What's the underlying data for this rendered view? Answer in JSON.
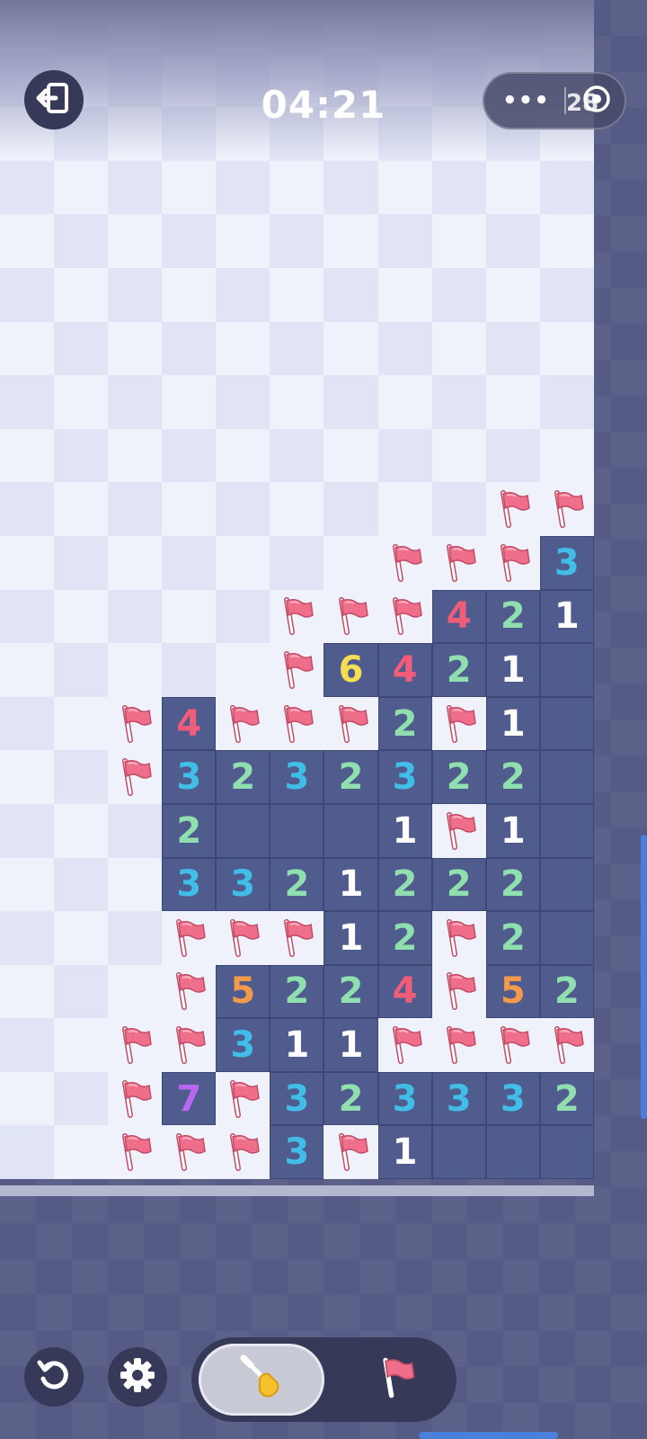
{
  "header": {
    "timer": "04:21",
    "capsule_dots": "•••",
    "flag_count": "28"
  },
  "icons": {
    "exit": "exit-door-icon",
    "restart": "restart-icon",
    "settings": "gear-icon",
    "dig": "shovel-icon",
    "flag": "flag-icon",
    "close": "close-circle-icon"
  },
  "colors": {
    "revealed": "#505c8e",
    "hidden_light": "#eff1fb",
    "hidden_dark": "#e0e4f4",
    "flag": "#ef6f8a",
    "n1": "#ffffff",
    "n2": "#8fe0ae",
    "n3": "#41bee8",
    "n4": "#ef5d78",
    "n5": "#f39a4a",
    "n6": "#f4df54",
    "n7": "#b768f2"
  },
  "board": {
    "cols": 11,
    "rows": [
      "...........",
      "...........",
      "...........",
      "...........",
      "...........",
      "...........",
      "...........",
      "...........",
      "...........",
      ".........FF",
      ".......FFF3",
      ".....FFF421",
      ".....F6421_",
      "..F4FFF2F1_",
      "..F32323 22_",
      "...2___1F1_",
      "...3321222_",
      "...FFF12F2_",
      "...F5224F52",
      "..FF311FFFF",
      "..F7F323332",
      "..FFF3F1___"
    ]
  }
}
